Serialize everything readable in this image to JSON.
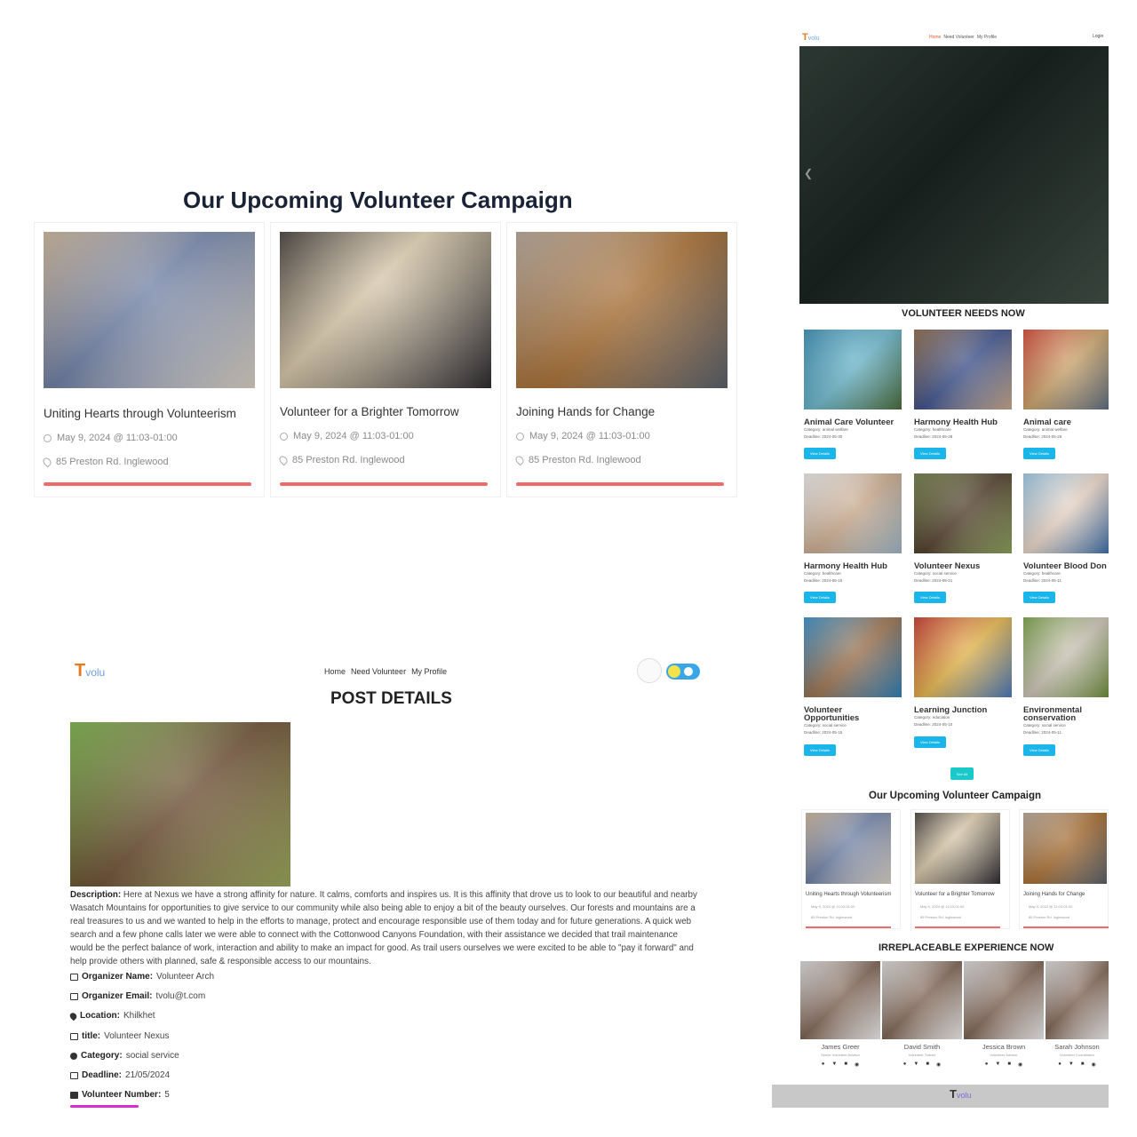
{
  "left_campaign": {
    "title": "Our Upcoming Volunteer Campaign",
    "cards": [
      {
        "title": "Uniting Hearts through Volunteerism",
        "date": "May 9, 2024 @ 11:03-01:00",
        "location": "85 Preston Rd. Inglewood"
      },
      {
        "title": "Volunteer for a Brighter Tomorrow",
        "date": "May 9, 2024 @ 11:03-01:00",
        "location": "85 Preston Rd. Inglewood"
      },
      {
        "title": "Joining Hands for Change",
        "date": "May 9, 2024 @ 11:03-01:00",
        "location": "85 Preston Rd. Inglewood"
      }
    ]
  },
  "right_panel": {
    "logo_t": "T",
    "logo_rest": "volu",
    "nav": [
      "Home",
      "Need Volunteer",
      "My Profile"
    ],
    "toggle_label": "Login",
    "needs_heading": "VOLUNTEER NEEDS NOW",
    "button_label": "View Details",
    "needs": [
      {
        "title": "Animal Care Volunteer",
        "category": "Category: animal welfare",
        "deadline": "Deadline: 2024-05-30"
      },
      {
        "title": "Harmony Health Hub",
        "category": "Category: healthcare",
        "deadline": "Deadline: 2024-05-28"
      },
      {
        "title": "Animal care",
        "category": "Category: animal welfare",
        "deadline": "Deadline: 2024-05-25"
      },
      {
        "title": "Harmony Health Hub",
        "category": "Category: healthcare",
        "deadline": "Deadline: 2024-05-15"
      },
      {
        "title": "Volunteer Nexus",
        "category": "Category: social service",
        "deadline": "Deadline: 2024-05-21"
      },
      {
        "title": "Volunteer Blood Don",
        "category": "Category: healthcare",
        "deadline": "Deadline: 2024-05-11"
      },
      {
        "title": "Volunteer Opportunities",
        "category": "Category: social service",
        "deadline": "Deadline: 2024-05-15"
      },
      {
        "title": "Learning Junction",
        "category": "Category: education",
        "deadline": "Deadline: 2024-05-10"
      },
      {
        "title": "Environmental conservation",
        "category": "Category: social service",
        "deadline": "Deadline: 2024-05-11"
      }
    ],
    "see_all_label": "See All",
    "campaign_heading": "Our Upcoming Volunteer Campaign",
    "campaign_cards": [
      {
        "title": "Uniting Hearts through Volunteerism",
        "date": "May 9, 2024 @ 11:03-01:00",
        "location": "85 Preston Rd. Inglewood"
      },
      {
        "title": "Volunteer for a Brighter Tomorrow",
        "date": "May 9, 2024 @ 11:03-01:00",
        "location": "85 Preston Rd. Inglewood"
      },
      {
        "title": "Joining Hands for Change",
        "date": "May 9, 2024 @ 11:03-01:00",
        "location": "85 Preston Rd. Inglewood"
      }
    ],
    "team_heading": "IRREPLACEABLE EXPERIENCE NOW",
    "team": [
      {
        "name": "James Greer",
        "role": "Senior Volunteer Advisor"
      },
      {
        "name": "David Smith",
        "role": "Volunteer Trainer"
      },
      {
        "name": "Jessica Brown",
        "role": "Volunteer Advisor"
      },
      {
        "name": "Sarah Johnson",
        "role": "Volunteer Coordinator"
      }
    ],
    "footer_logo_t": "T",
    "footer_logo_rest": "volu"
  },
  "post_details": {
    "logo_t": "T",
    "logo_rest": "volu",
    "nav": [
      "Home",
      "Need Volunteer",
      "My Profile"
    ],
    "title": "POST DETAILS",
    "description_label": "Description:",
    "description": "Here at Nexus we have a strong affinity for nature. It calms, comforts and inspires us. It is this affinity that drove us to look to our beautiful and nearby Wasatch Mountains for opportunities to give service to our community while also being able to enjoy a bit of the beauty ourselves. Our forests and mountains are a real treasures to us and we wanted to help in the efforts to manage, protect and encourage responsible use of them today and for future generations. A quick web search and a few phone calls later we were able to connect with the Cottonwood Canyons Foundation, with their assistance we decided that trail maintenance would be the perfect balance of work, interaction and ability to make an impact for good. As trail users ourselves we were excited to be able to \"pay it forward\" and help provide others with planned, safe & responsible access to our mountains.",
    "fields": [
      {
        "label": "Organizer Name:",
        "value": "Volunteer Arch"
      },
      {
        "label": "Organizer Email:",
        "value": "tvolu@t.com"
      },
      {
        "label": "Location:",
        "value": "Khilkhet"
      },
      {
        "label": "title:",
        "value": "Volunteer Nexus"
      },
      {
        "label": "Category:",
        "value": "social service"
      },
      {
        "label": "Deadline:",
        "value": "21/05/2024"
      },
      {
        "label": "Volunteer Number:",
        "value": "5"
      }
    ]
  },
  "colors": {
    "accent_red": "#ee6b6b",
    "button_blue": "#1ab6ea",
    "logo_orange": "#e87a1e"
  },
  "icons": [
    "clock-icon",
    "location-pin-icon",
    "facebook-icon",
    "twitter-icon",
    "youtube-icon",
    "pinterest-icon",
    "briefcase-icon",
    "mail-icon",
    "map-pin-icon",
    "document-icon",
    "category-icon",
    "calendar-icon",
    "id-card-icon"
  ]
}
